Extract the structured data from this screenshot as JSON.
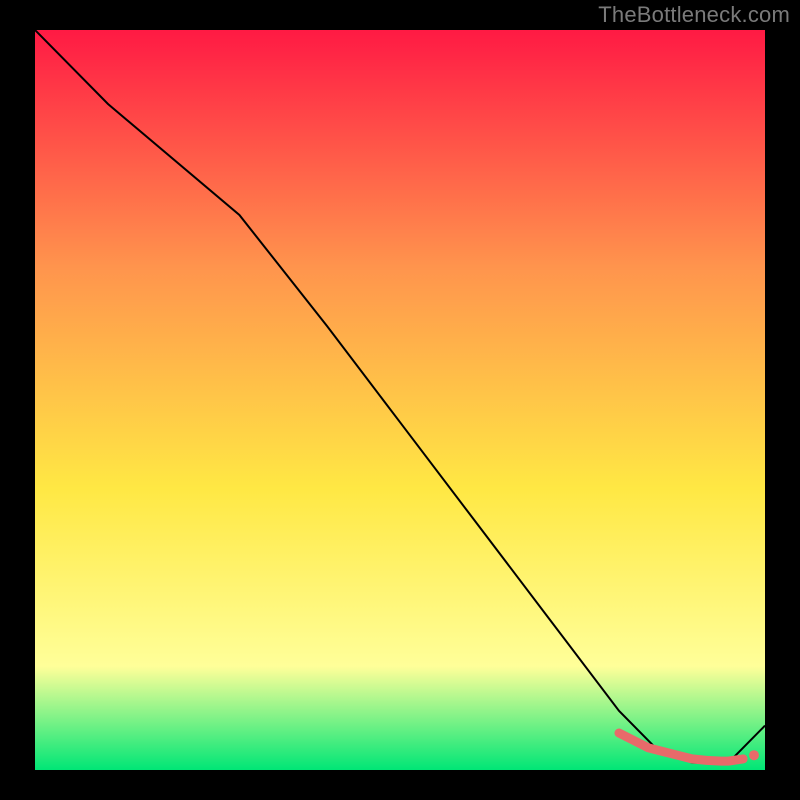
{
  "watermark": "TheBottleneck.com",
  "chart_data": {
    "type": "line",
    "title": "",
    "xlabel": "",
    "ylabel": "",
    "xlim": [
      0,
      100
    ],
    "ylim": [
      0,
      100
    ],
    "background_gradient": {
      "top_color": "#ff1a44",
      "mid_upper_color": "#ff944d",
      "mid_lower_color": "#ffe844",
      "lower_color": "#ffff99",
      "bottom_color": "#00e676"
    },
    "series": [
      {
        "name": "bottleneck-curve",
        "color": "#000000",
        "x": [
          0,
          10,
          28,
          40,
          50,
          60,
          70,
          80,
          85,
          90,
          95,
          100
        ],
        "y": [
          100,
          90,
          75,
          60,
          47,
          34,
          21,
          8,
          3,
          1,
          1,
          6
        ]
      }
    ],
    "markers": {
      "name": "highlight-range",
      "color": "#e86a6a",
      "x": [
        80,
        82,
        84,
        86,
        88,
        90,
        92,
        94,
        95,
        97
      ],
      "y": [
        5,
        4,
        3,
        2.5,
        2,
        1.5,
        1.3,
        1.2,
        1.2,
        1.5
      ]
    }
  }
}
